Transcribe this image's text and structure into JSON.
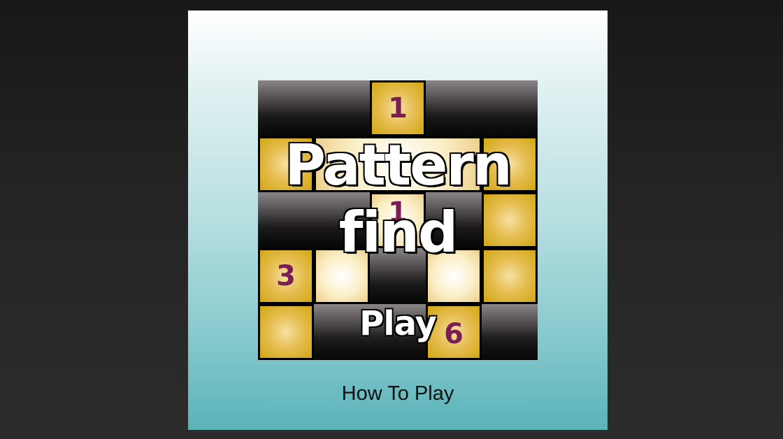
{
  "game": {
    "title_line1": "Pattern",
    "title_line2": "find",
    "play_label": "Play",
    "how_to_play_label": "How To Play"
  },
  "board_numbers": {
    "top": "1",
    "middle": "1",
    "left": "3",
    "bottom": "6"
  },
  "colors": {
    "gold": "#d3a614",
    "number": "#7a1f55",
    "panel_top": "#ffffff",
    "panel_bottom": "#5ab3b9",
    "background": "#1f1f1f"
  }
}
